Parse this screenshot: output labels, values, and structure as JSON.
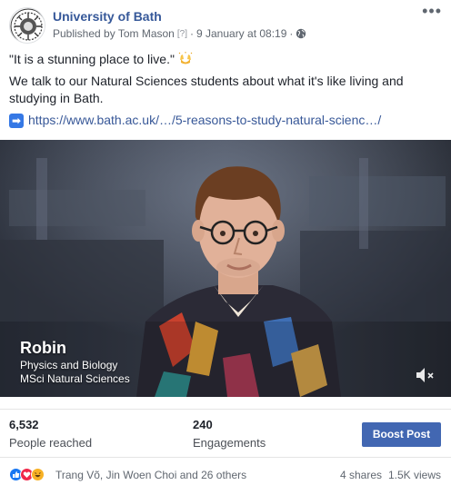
{
  "page": {
    "name": "University of Bath",
    "published_by": "Published by Tom Mason",
    "help_marker": "[?]",
    "separator": "·",
    "timestamp": "9 January at 08:19",
    "privacy_icon": "globe-icon",
    "more_icon": "more-options-icon"
  },
  "post": {
    "quote": "\"It is a stunning place to live.\"",
    "quote_emoji": "raised-hands-emoji",
    "body": "We talk to our Natural Sciences students about what it's like living and studying in Bath.",
    "link_icon": "arrow-right-icon",
    "link": "https://www.bath.ac.uk/…/5-reasons-to-study-natural-scienc…/"
  },
  "video": {
    "name": "Robin",
    "line1": "Physics and Biology",
    "line2": "MSci Natural Sciences",
    "mute_icon": "speaker-muted-icon"
  },
  "stats": {
    "reached_value": "6,532",
    "reached_label": "People reached",
    "engagements_value": "240",
    "engagements_label": "Engagements",
    "boost_label": "Boost Post"
  },
  "footer": {
    "reaction_icons": [
      "like-icon",
      "love-icon",
      "haha-icon"
    ],
    "reaction_names": "Trang Võ, Jin Woen Choi and 26 others",
    "shares": "4 shares",
    "views": "1.5K views"
  },
  "colors": {
    "link": "#385898",
    "page_name": "#365899",
    "boost_button": "#4267b2",
    "like": "#1877f2",
    "love": "#f0284a",
    "haha": "#f7b125"
  }
}
